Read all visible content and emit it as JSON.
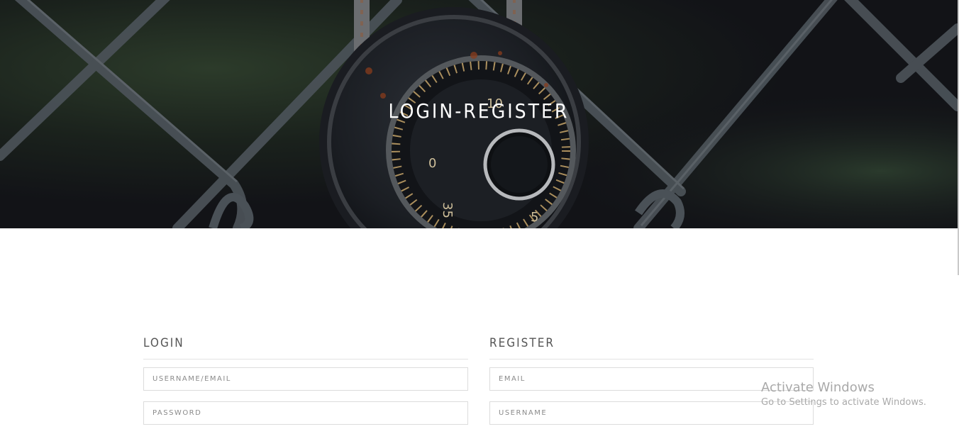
{
  "hero": {
    "title": "LOGIN-REGISTER",
    "background": "padlock-on-chain-link-fence-image"
  },
  "login": {
    "heading": "LOGIN",
    "username_placeholder": "USERNAME/EMAIL",
    "password_placeholder": "PASSWORD"
  },
  "register": {
    "heading": "REGISTER",
    "email_placeholder": "EMAIL",
    "username_placeholder": "USERNAME"
  },
  "watermark": {
    "title": "Activate Windows",
    "subtitle": "Go to Settings to activate Windows."
  },
  "colors": {
    "heading_text": "#555555",
    "field_border": "#dcdcdc",
    "hero_title": "#ffffff"
  }
}
